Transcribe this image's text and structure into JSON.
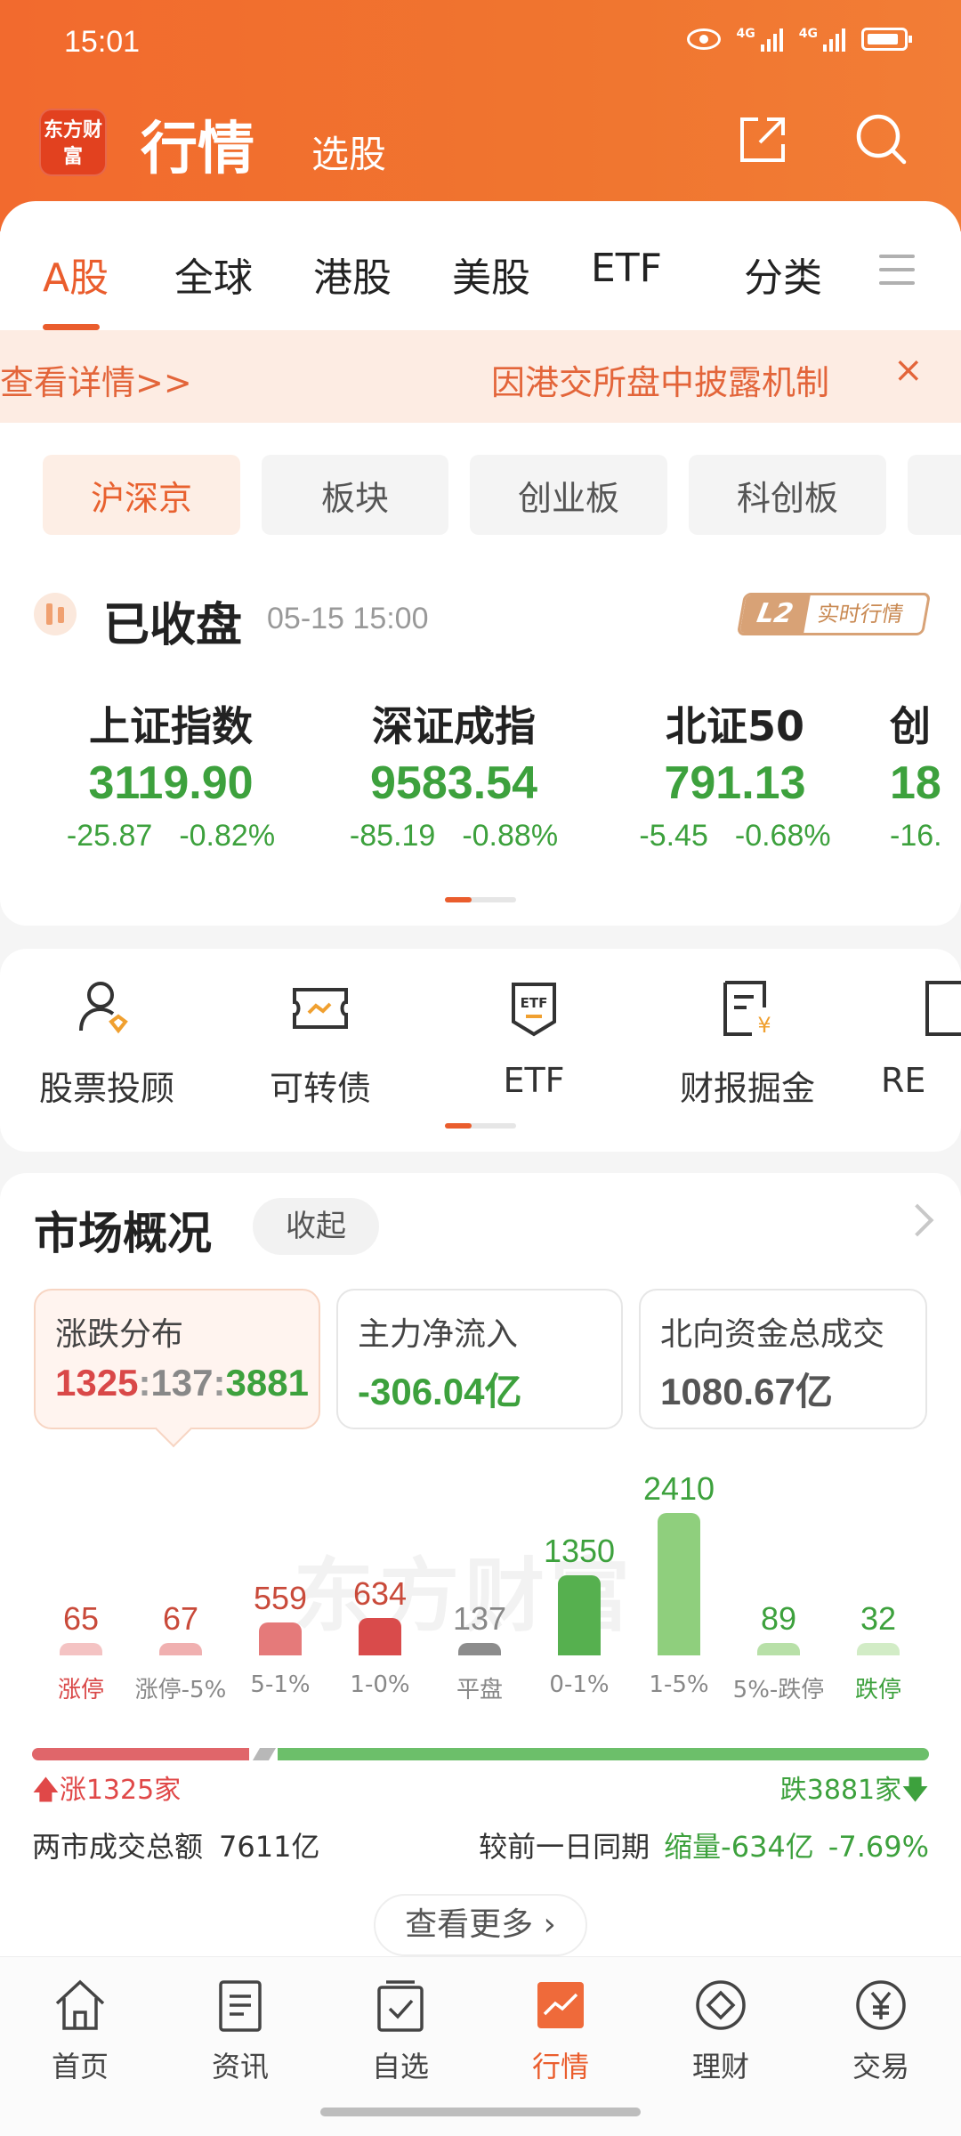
{
  "status_bar": {
    "time": "15:01",
    "network": "4G"
  },
  "app": {
    "logo_text": "东方财富",
    "title": "行情",
    "subtitle": "选股"
  },
  "tabs": [
    "A股",
    "全球",
    "港股",
    "美股",
    "ETF",
    "分类"
  ],
  "notice": {
    "left_text": "查看详情>>",
    "main_text": "因港交所盘中披露机制",
    "close": "×"
  },
  "sub_tabs": [
    "沪深京",
    "板块",
    "创业板",
    "科创板"
  ],
  "market_status": {
    "title": "已收盘",
    "time": "05-15 15:00",
    "badge_l2": "L2",
    "badge_text": "实时行情"
  },
  "indices": [
    {
      "name": "上证指数",
      "value": "3119.90",
      "change": "-25.87",
      "pct": "-0.82%"
    },
    {
      "name": "深证成指",
      "value": "9583.54",
      "change": "-85.19",
      "pct": "-0.88%"
    },
    {
      "name": "北证50",
      "value": "791.13",
      "change": "-5.45",
      "pct": "-0.68%"
    },
    {
      "name": "创",
      "value": "18",
      "change": "-16.",
      "pct": ""
    }
  ],
  "tools": [
    "股票投顾",
    "可转债",
    "ETF",
    "财报掘金",
    "RE"
  ],
  "market_overview": {
    "title": "市场概况",
    "collapse": "收起",
    "stats": {
      "distribution": {
        "label": "涨跌分布",
        "up": "1325",
        "flat": "137",
        "down": "3881",
        "sep": ":"
      },
      "main_flow": {
        "label": "主力净流入",
        "value": "-306.04亿"
      },
      "northbound": {
        "label": "北向资金总成交",
        "value": "1080.67亿"
      }
    },
    "watermark": "东方财富",
    "up_label": "涨1325家",
    "down_label": "跌3881家",
    "turnover_label": "两市成交总额",
    "turnover_value": "7611亿",
    "compare_label": "较前一日同期",
    "compare_value": "缩量-634亿",
    "compare_pct": "-7.69%",
    "more": "查看更多"
  },
  "chart_data": {
    "type": "bar",
    "categories": [
      "涨停",
      "涨停-5%",
      "5-1%",
      "1-0%",
      "平盘",
      "0-1%",
      "1-5%",
      "5%-跌停",
      "跌停"
    ],
    "values": [
      65,
      67,
      559,
      634,
      137,
      1350,
      2410,
      89,
      32
    ],
    "colors": [
      "#f4c3c3",
      "#f0b0b0",
      "#e57a7a",
      "#d94b4b",
      "#8c8c8c",
      "#56b04f",
      "#8fcf7d",
      "#b8e0a8",
      "#d2ecc6"
    ],
    "label_colors": [
      "#c94a3a",
      "#c94a3a",
      "#c94a3a",
      "#c94a3a",
      "#888888",
      "#3da13d",
      "#3da13d",
      "#3da13d",
      "#3da13d"
    ]
  },
  "bottom_nav": [
    "首页",
    "资讯",
    "自选",
    "行情",
    "理财",
    "交易"
  ],
  "colors": {
    "accent": "#ea5d2d",
    "up": "#e04848",
    "down": "#3da13d"
  }
}
